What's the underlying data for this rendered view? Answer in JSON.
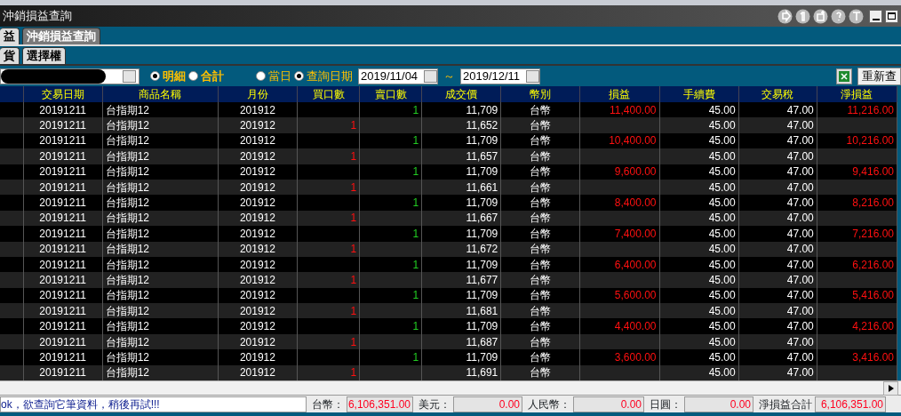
{
  "window": {
    "title": "沖銷損益查詢"
  },
  "tabs": [
    {
      "label": "益",
      "selected": false
    },
    {
      "label": "沖銷損益查詢",
      "selected": true
    }
  ],
  "subtabs": [
    {
      "label": "貨",
      "selected": false
    },
    {
      "label": "選擇權",
      "selected": false
    }
  ],
  "view_mode": [
    {
      "label": "明細",
      "selected": true
    },
    {
      "label": "合計",
      "selected": false
    }
  ],
  "date_mode": [
    {
      "label": "當日",
      "selected": false
    },
    {
      "label": "查詢日期",
      "selected": true
    }
  ],
  "date_from": "2019/11/04",
  "date_separator": "～",
  "date_to": "2019/12/11",
  "requery_button": "重新查",
  "table": {
    "columns": [
      "交易日期",
      "商品名稱",
      "月份",
      "買口數",
      "賣口數",
      "成交價",
      "幣別",
      "損益",
      "手續費",
      "交易稅",
      "淨損益"
    ],
    "rows": [
      [
        "20191211",
        "台指期12",
        "201912",
        "",
        "1",
        "11,709",
        "台幣",
        "11,400.00",
        "45.00",
        "47.00",
        "11,216.00"
      ],
      [
        "20191211",
        "台指期12",
        "201912",
        "1",
        "",
        "11,652",
        "台幣",
        "",
        "45.00",
        "47.00",
        ""
      ],
      [
        "20191211",
        "台指期12",
        "201912",
        "",
        "1",
        "11,709",
        "台幣",
        "10,400.00",
        "45.00",
        "47.00",
        "10,216.00"
      ],
      [
        "20191211",
        "台指期12",
        "201912",
        "1",
        "",
        "11,657",
        "台幣",
        "",
        "45.00",
        "47.00",
        ""
      ],
      [
        "20191211",
        "台指期12",
        "201912",
        "",
        "1",
        "11,709",
        "台幣",
        "9,600.00",
        "45.00",
        "47.00",
        "9,416.00"
      ],
      [
        "20191211",
        "台指期12",
        "201912",
        "1",
        "",
        "11,661",
        "台幣",
        "",
        "45.00",
        "47.00",
        ""
      ],
      [
        "20191211",
        "台指期12",
        "201912",
        "",
        "1",
        "11,709",
        "台幣",
        "8,400.00",
        "45.00",
        "47.00",
        "8,216.00"
      ],
      [
        "20191211",
        "台指期12",
        "201912",
        "1",
        "",
        "11,667",
        "台幣",
        "",
        "45.00",
        "47.00",
        ""
      ],
      [
        "20191211",
        "台指期12",
        "201912",
        "",
        "1",
        "11,709",
        "台幣",
        "7,400.00",
        "45.00",
        "47.00",
        "7,216.00"
      ],
      [
        "20191211",
        "台指期12",
        "201912",
        "1",
        "",
        "11,672",
        "台幣",
        "",
        "45.00",
        "47.00",
        ""
      ],
      [
        "20191211",
        "台指期12",
        "201912",
        "",
        "1",
        "11,709",
        "台幣",
        "6,400.00",
        "45.00",
        "47.00",
        "6,216.00"
      ],
      [
        "20191211",
        "台指期12",
        "201912",
        "1",
        "",
        "11,677",
        "台幣",
        "",
        "45.00",
        "47.00",
        ""
      ],
      [
        "20191211",
        "台指期12",
        "201912",
        "",
        "1",
        "11,709",
        "台幣",
        "5,600.00",
        "45.00",
        "47.00",
        "5,416.00"
      ],
      [
        "20191211",
        "台指期12",
        "201912",
        "1",
        "",
        "11,681",
        "台幣",
        "",
        "45.00",
        "47.00",
        ""
      ],
      [
        "20191211",
        "台指期12",
        "201912",
        "",
        "1",
        "11,709",
        "台幣",
        "4,400.00",
        "45.00",
        "47.00",
        "4,216.00"
      ],
      [
        "20191211",
        "台指期12",
        "201912",
        "1",
        "",
        "11,687",
        "台幣",
        "",
        "45.00",
        "47.00",
        ""
      ],
      [
        "20191211",
        "台指期12",
        "201912",
        "",
        "1",
        "11,709",
        "台幣",
        "3,600.00",
        "45.00",
        "47.00",
        "3,416.00"
      ],
      [
        "20191211",
        "台指期12",
        "201912",
        "1",
        "",
        "11,691",
        "台幣",
        "",
        "45.00",
        "47.00",
        ""
      ]
    ]
  },
  "status_bar": {
    "message": "ok，欲查詢它筆資料，稍後再試!!!",
    "totals": [
      {
        "label": "台幣：",
        "value": "6,106,351.00"
      },
      {
        "label": "美元：",
        "value": "0.00"
      },
      {
        "label": "人民幣：",
        "value": "0.00"
      },
      {
        "label": "日圓：",
        "value": "0.00"
      },
      {
        "label": "淨損益合計",
        "value": "6,106,351.00"
      }
    ]
  }
}
